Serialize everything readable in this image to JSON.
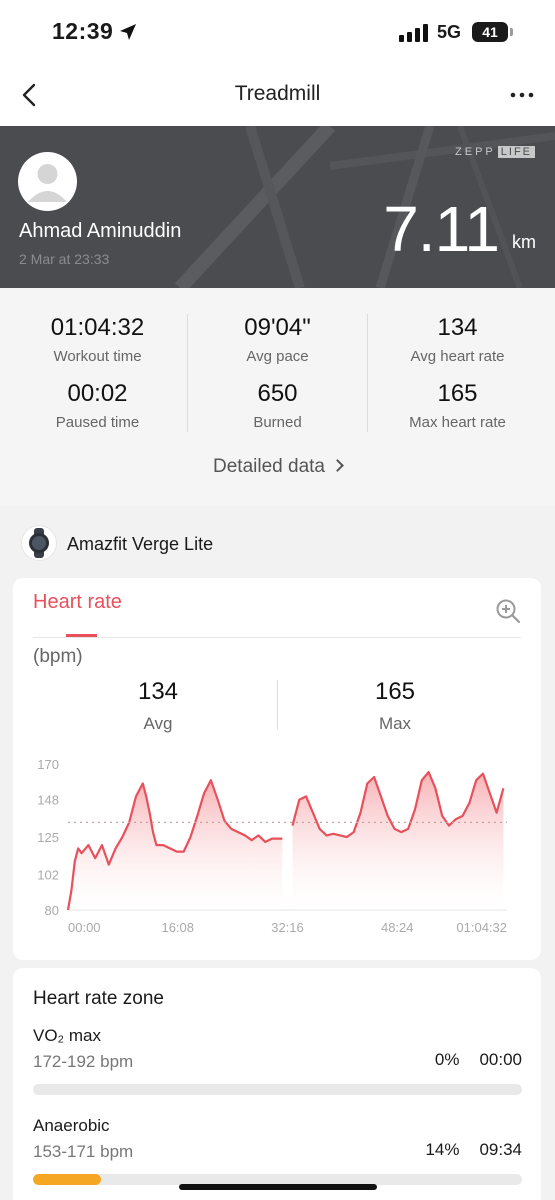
{
  "status_bar": {
    "time": "12:39",
    "network": "5G",
    "battery": "41"
  },
  "nav": {
    "title": "Treadmill"
  },
  "hero": {
    "brand": "ZEPP",
    "brand_badge": "LIFE",
    "user_name": "Ahmad Aminuddin",
    "date": "2 Mar at 23:33",
    "distance": "7.11",
    "distance_unit": "km"
  },
  "stats": {
    "items": [
      {
        "value": "01:04:32",
        "label": "Workout time"
      },
      {
        "value": "09'04\"",
        "label": "Avg pace"
      },
      {
        "value": "134",
        "label": "Avg heart rate"
      },
      {
        "value": "00:02",
        "label": "Paused time"
      },
      {
        "value": "650",
        "label": "Burned"
      },
      {
        "value": "165",
        "label": "Max heart rate"
      }
    ],
    "detailed_link": "Detailed data"
  },
  "device": {
    "name": "Amazfit Verge Lite"
  },
  "heart_rate": {
    "tab_label": "Heart rate",
    "unit": "(bpm)",
    "avg_value": "134",
    "avg_label": "Avg",
    "max_value": "165",
    "max_label": "Max"
  },
  "chart_data": {
    "type": "area",
    "title": "Heart rate",
    "ylabel": "(bpm)",
    "yticks": [
      80,
      102,
      125,
      148,
      170
    ],
    "ylim": [
      80,
      170
    ],
    "xticks": [
      "00:00",
      "16:08",
      "32:16",
      "48:24",
      "01:04:32"
    ],
    "xlim_minutes": [
      0,
      64.53
    ],
    "average_line": 134,
    "series": [
      {
        "segment": "before-pause",
        "x_minutes": [
          0,
          0.5,
          1,
          1.5,
          2,
          3,
          4,
          5,
          6,
          7,
          8,
          9,
          10,
          11,
          11.5,
          12,
          12.5,
          13,
          14,
          15,
          16,
          17,
          18,
          19,
          20,
          21,
          22,
          23,
          24,
          25,
          26,
          27,
          28,
          29,
          30,
          31.5
        ],
        "values": [
          80,
          92,
          110,
          118,
          115,
          120,
          112,
          120,
          108,
          118,
          125,
          134,
          150,
          158,
          150,
          140,
          128,
          120,
          120,
          118,
          116,
          116,
          125,
          138,
          152,
          160,
          148,
          135,
          130,
          128,
          126,
          123,
          126,
          122,
          124,
          124
        ]
      },
      {
        "segment": "after-pause",
        "x_minutes": [
          33,
          34,
          35,
          36,
          37,
          38,
          39,
          40,
          41,
          42,
          43,
          44,
          45,
          46,
          47,
          48,
          49,
          50,
          51,
          52,
          53,
          54,
          55,
          56,
          57,
          58,
          59,
          60,
          61,
          62,
          63,
          64
        ],
        "values": [
          132,
          148,
          150,
          140,
          130,
          126,
          127,
          126,
          125,
          128,
          140,
          158,
          162,
          150,
          138,
          130,
          128,
          130,
          142,
          160,
          165,
          155,
          138,
          132,
          136,
          138,
          146,
          160,
          164,
          152,
          140,
          155
        ]
      }
    ],
    "colors": {
      "line": "#e8505b",
      "fill_top": "#f7a9ad",
      "avg_line": "#c9a0a3"
    }
  },
  "zones": {
    "title": "Heart rate zone",
    "items": [
      {
        "name": "VO₂ max",
        "range": "172-192 bpm",
        "percent": "0%",
        "time": "00:00",
        "fraction": 0.0,
        "color": "#f5a623"
      },
      {
        "name": "Anaerobic",
        "range": "153-171 bpm",
        "percent": "14%",
        "time": "09:34",
        "fraction": 0.14,
        "color": "#f5a623"
      }
    ]
  }
}
